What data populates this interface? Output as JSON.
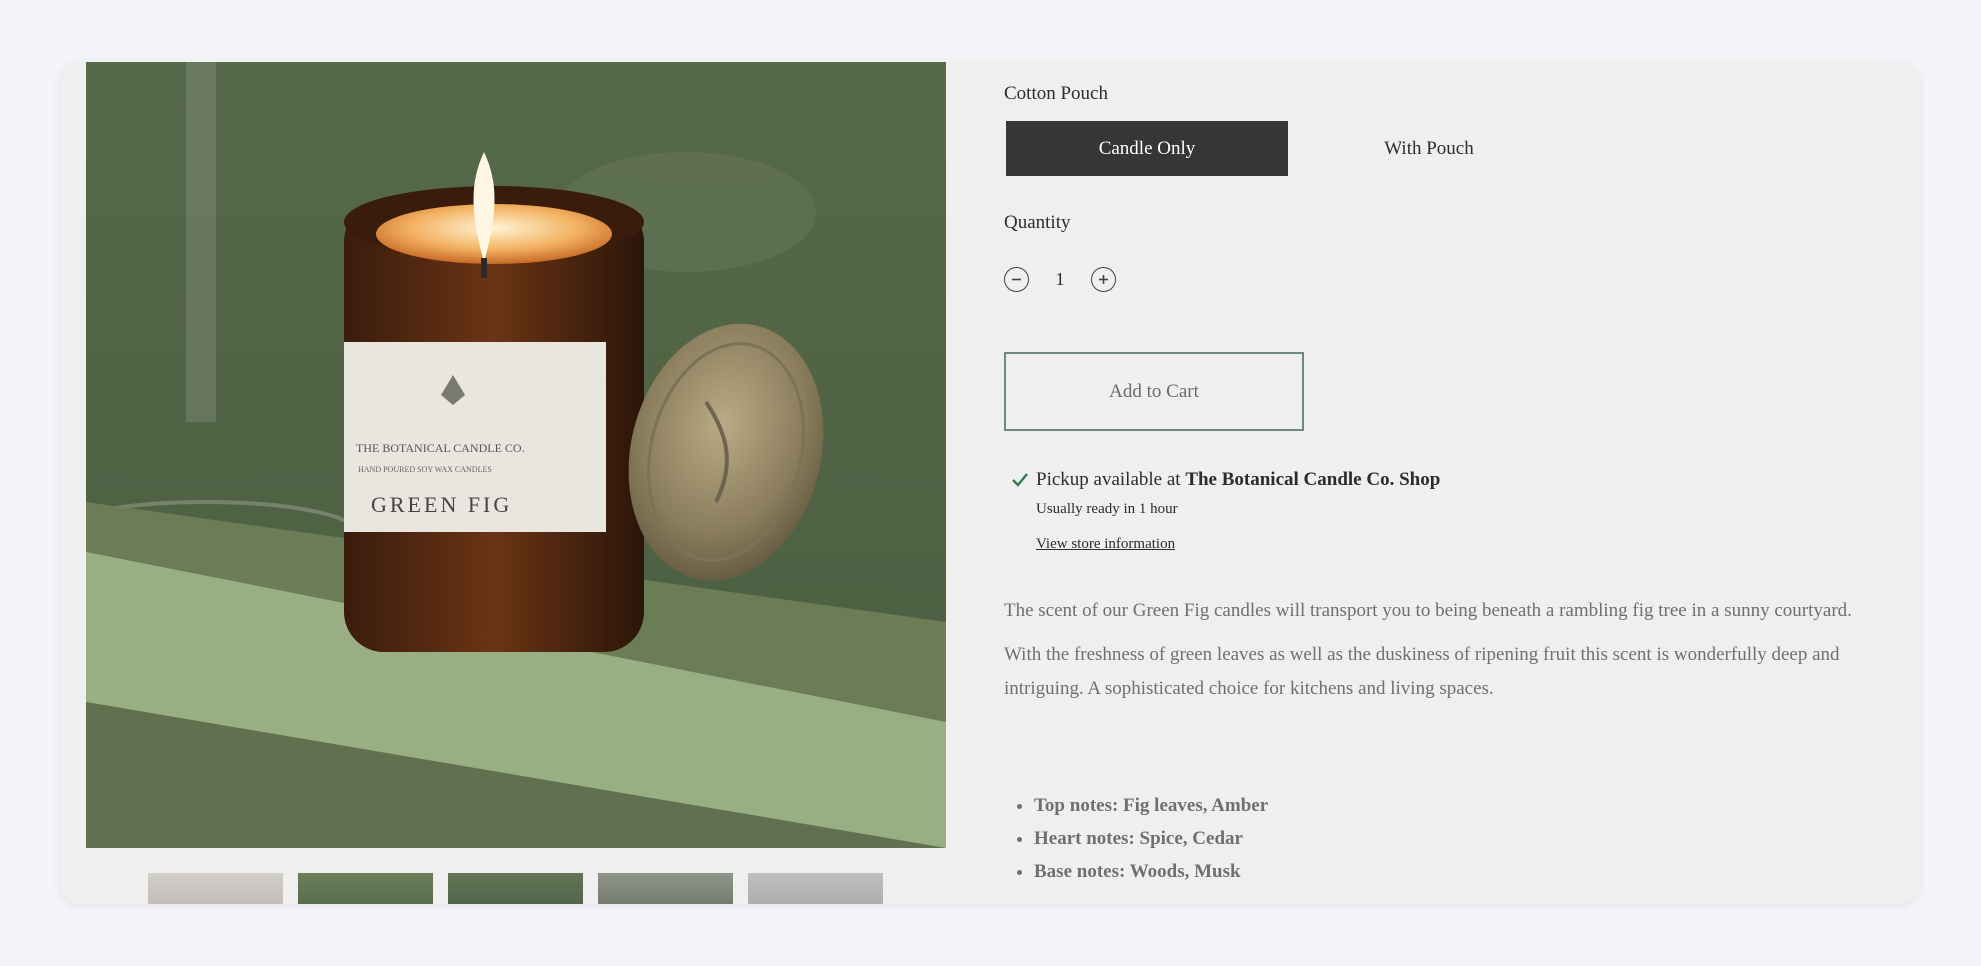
{
  "product": {
    "variant_label": "Cotton Pouch",
    "variants": [
      {
        "label": "Candle Only",
        "selected": true
      },
      {
        "label": "With Pouch",
        "selected": false
      }
    ],
    "quantity_label": "Quantity",
    "quantity_value": "1",
    "add_to_cart_label": "Add to Cart"
  },
  "image": {
    "jar_label_line1": "THE BOTANICAL CANDLE CO.",
    "jar_label_line2": "HAND POURED SOY WAX CANDLES",
    "jar_label_name": "GREEN FIG"
  },
  "pickup": {
    "prefix": "Pickup available at ",
    "store": "The Botanical Candle Co. Shop",
    "ready": "Usually ready in 1 hour",
    "link": "View store information"
  },
  "description": {
    "p1": "The scent of our Green Fig candles will transport you to being beneath a rambling fig tree in a sunny courtyard.",
    "p2": "With the freshness of green leaves as well as the duskiness of ripening fruit this scent is wonderfully deep and intriguing. A sophisticated choice for kitchens and living spaces."
  },
  "notes": [
    "Top notes: Fig leaves, Amber",
    "Heart notes: Spice, Cedar",
    "Base notes: Woods, Musk"
  ],
  "colors": {
    "selected_variant_bg": "#363636",
    "button_border": "#6c8a78",
    "check": "#2e7d4f",
    "card_bg": "#efefef"
  }
}
